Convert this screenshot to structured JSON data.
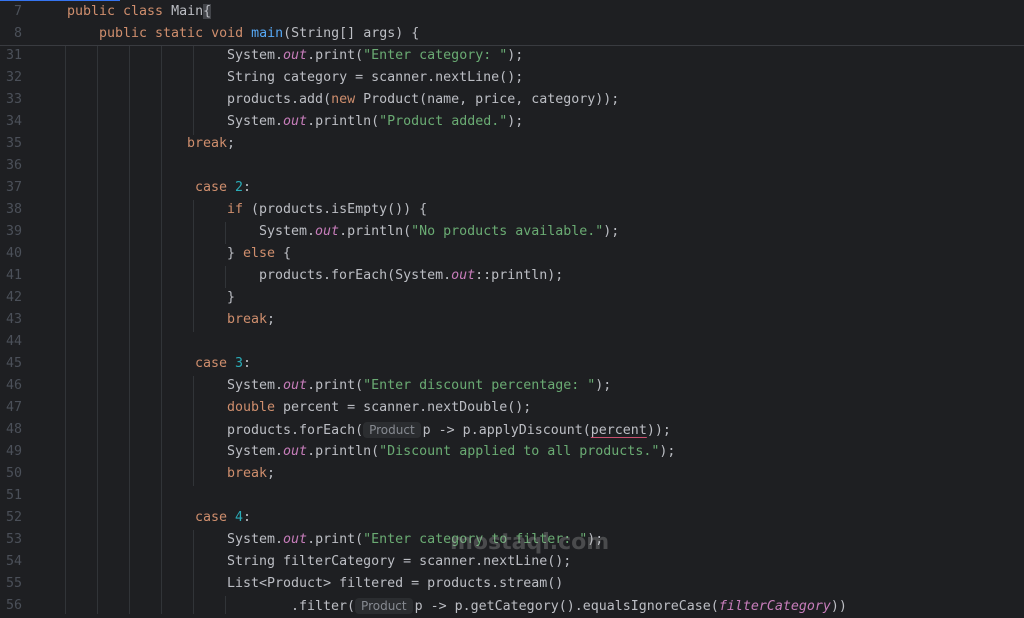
{
  "editor": {
    "colors": {
      "background": "#1e1f22",
      "keyword": "#cf8e6d",
      "string": "#6aab73",
      "number": "#2aacb8",
      "method": "#56a8f5",
      "static_field": "#c77dbb"
    },
    "sticky_lines": [
      {
        "n": "7",
        "indent": 0,
        "tokens": [
          [
            "kw",
            "public class "
          ],
          [
            "plain",
            "Main"
          ],
          [
            "caret",
            "{"
          ]
        ]
      },
      {
        "n": "8",
        "indent": 4,
        "tokens": [
          [
            "kw",
            "public static void "
          ],
          [
            "fn",
            "main"
          ],
          [
            "plain",
            "(String[] args) {"
          ]
        ]
      }
    ],
    "lines": [
      {
        "n": "31",
        "indent": 20,
        "tokens": [
          [
            "plain",
            "System."
          ],
          [
            "fld",
            "out"
          ],
          [
            "plain",
            ".print("
          ],
          [
            "str",
            "\"Enter category: \""
          ],
          [
            "plain",
            ");"
          ]
        ]
      },
      {
        "n": "32",
        "indent": 20,
        "tokens": [
          [
            "plain",
            "String category = scanner.nextLine();"
          ]
        ]
      },
      {
        "n": "33",
        "indent": 20,
        "tokens": [
          [
            "plain",
            "products.add("
          ],
          [
            "kw",
            "new "
          ],
          [
            "plain",
            "Product(name, price, category));"
          ]
        ]
      },
      {
        "n": "34",
        "indent": 20,
        "tokens": [
          [
            "plain",
            "System."
          ],
          [
            "fld",
            "out"
          ],
          [
            "plain",
            ".println("
          ],
          [
            "str",
            "\"Product added.\""
          ],
          [
            "plain",
            ");"
          ]
        ]
      },
      {
        "n": "35",
        "indent": 15,
        "tokens": [
          [
            "kw",
            "break"
          ],
          [
            "plain",
            ";"
          ]
        ]
      },
      {
        "n": "36",
        "indent": 0,
        "tokens": []
      },
      {
        "n": "37",
        "indent": 16,
        "tokens": [
          [
            "kw",
            "case "
          ],
          [
            "num",
            "2"
          ],
          [
            "plain",
            ":"
          ]
        ]
      },
      {
        "n": "38",
        "indent": 20,
        "tokens": [
          [
            "kw",
            "if "
          ],
          [
            "plain",
            "(products.isEmpty()) {"
          ]
        ]
      },
      {
        "n": "39",
        "indent": 24,
        "tokens": [
          [
            "plain",
            "System."
          ],
          [
            "fld",
            "out"
          ],
          [
            "plain",
            ".println("
          ],
          [
            "str",
            "\"No products available.\""
          ],
          [
            "plain",
            ");"
          ]
        ]
      },
      {
        "n": "40",
        "indent": 20,
        "tokens": [
          [
            "plain",
            "} "
          ],
          [
            "kw",
            "else "
          ],
          [
            "plain",
            "{"
          ]
        ]
      },
      {
        "n": "41",
        "indent": 24,
        "tokens": [
          [
            "plain",
            "products.forEach(System."
          ],
          [
            "fld",
            "out"
          ],
          [
            "plain",
            "::println);"
          ]
        ]
      },
      {
        "n": "42",
        "indent": 20,
        "tokens": [
          [
            "plain",
            "}"
          ]
        ]
      },
      {
        "n": "43",
        "indent": 20,
        "tokens": [
          [
            "kw",
            "break"
          ],
          [
            "plain",
            ";"
          ]
        ]
      },
      {
        "n": "44",
        "indent": 0,
        "tokens": []
      },
      {
        "n": "45",
        "indent": 16,
        "tokens": [
          [
            "kw",
            "case "
          ],
          [
            "num",
            "3"
          ],
          [
            "plain",
            ":"
          ]
        ]
      },
      {
        "n": "46",
        "indent": 20,
        "tokens": [
          [
            "plain",
            "System."
          ],
          [
            "fld",
            "out"
          ],
          [
            "plain",
            ".print("
          ],
          [
            "str",
            "\"Enter discount percentage: \""
          ],
          [
            "plain",
            ");"
          ]
        ]
      },
      {
        "n": "47",
        "indent": 20,
        "tokens": [
          [
            "kw",
            "double "
          ],
          [
            "plain",
            "percent = scanner.nextDouble();"
          ]
        ]
      },
      {
        "n": "48",
        "indent": 20,
        "tokens": [
          [
            "plain",
            "products.forEach("
          ],
          [
            "hint",
            "Product"
          ],
          [
            "plain",
            "p -> p.applyDiscount("
          ],
          [
            "warn",
            "percent"
          ],
          [
            "plain",
            "));"
          ]
        ]
      },
      {
        "n": "49",
        "indent": 20,
        "tokens": [
          [
            "plain",
            "System."
          ],
          [
            "fld",
            "out"
          ],
          [
            "plain",
            ".println("
          ],
          [
            "str",
            "\"Discount applied to all products.\""
          ],
          [
            "plain",
            ");"
          ]
        ]
      },
      {
        "n": "50",
        "indent": 20,
        "tokens": [
          [
            "kw",
            "break"
          ],
          [
            "plain",
            ";"
          ]
        ]
      },
      {
        "n": "51",
        "indent": 0,
        "tokens": []
      },
      {
        "n": "52",
        "indent": 16,
        "tokens": [
          [
            "kw",
            "case "
          ],
          [
            "num",
            "4"
          ],
          [
            "plain",
            ":"
          ]
        ]
      },
      {
        "n": "53",
        "indent": 20,
        "tokens": [
          [
            "plain",
            "System."
          ],
          [
            "fld",
            "out"
          ],
          [
            "plain",
            ".print("
          ],
          [
            "str",
            "\"Enter category to filter: \""
          ],
          [
            "plain",
            ");"
          ]
        ]
      },
      {
        "n": "54",
        "indent": 20,
        "tokens": [
          [
            "plain",
            "String filterCategory = scanner.nextLine();"
          ]
        ]
      },
      {
        "n": "55",
        "indent": 20,
        "tokens": [
          [
            "plain",
            "List<Product> filtered = products.stream()"
          ]
        ]
      },
      {
        "n": "56",
        "indent": 28,
        "tokens": [
          [
            "plain",
            ".filter("
          ],
          [
            "hint",
            "Product"
          ],
          [
            "plain",
            "p -> p.getCategory().equalsIgnoreCase("
          ],
          [
            "fld",
            "filterCategory"
          ],
          [
            "plain",
            "))"
          ]
        ]
      }
    ]
  },
  "watermark": "mostaql.com"
}
